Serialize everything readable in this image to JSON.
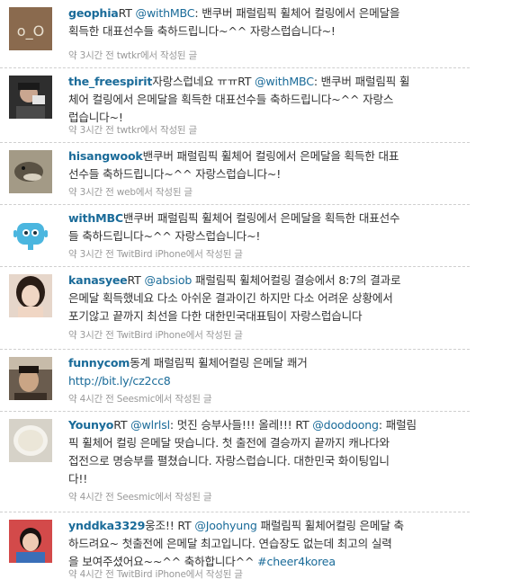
{
  "tweets": [
    {
      "user": "geophia",
      "avatar": "geophia-avatar",
      "parts": [
        "RT ",
        "@withMBC",
        ": 밴쿠버 패럴림픽 휠체어 컬링에서 은메달을",
        "획득한 대표선수들 축하드립니다~^^ 자랑스럽습니다~!"
      ],
      "meta": "약 3시간 전 twtkr에서 작성된 글"
    },
    {
      "user": "the_freespirit",
      "avatar": "person-avatar",
      "parts": [
        "자랑스럽네요 ㅠㅠRT ",
        "@withMBC",
        ": 밴쿠버 패럴림픽 휠",
        "체어 컬링에서 은메달을 획득한 대표선수들 축하드립니다~^^ 자랑스",
        "럽습니다~!"
      ],
      "meta": "약 3시간 전 twtkr에서 작성된 글"
    },
    {
      "user": "hisangwook",
      "avatar": "lizard-avatar",
      "parts": [
        "밴쿠버 패럴림픽 휠체어 컬링에서 은메달을 획득한 대표",
        "선수들 축하드립니다~^^ 자랑스럽습니다~!"
      ],
      "meta": "약 3시간 전 web에서 작성된 글"
    },
    {
      "user": "withMBC",
      "avatar": "robot-avatar",
      "parts": [
        "밴쿠버 패럴림픽 휠체어 컬링에서 은메달을 획득한 대표선수",
        "들 축하드립니다~^^ 자랑스럽습니다~!"
      ],
      "meta": "약 3시간 전 TwitBird iPhone에서 작성된 글"
    },
    {
      "user": "kanasyee",
      "avatar": "girl-avatar",
      "parts": [
        "RT ",
        "@absiob",
        " 패럴림픽 휠체어컬링 결승에서 8:7의 결과로",
        "은메달 획득했네요 다소 아쉬운 결과이긴 하지만 다소 어려운 상황에서",
        "포기않고 끝까지 최선을 다한 대한민국대표팀이 자랑스럽습니다"
      ],
      "meta": "약 3시간 전 TwitBird iPhone에서 작성된 글"
    },
    {
      "user": "funnycom",
      "avatar": "man-avatar",
      "parts": [
        "동계 패럴림픽 휠체어컬링 은메달 쾌거",
        "http://bit.ly/cz2cc8"
      ],
      "meta": "약 4시간 전 Seesmic에서 작성된 글"
    },
    {
      "user": "Younyo",
      "avatar": "cup-avatar",
      "parts": [
        "RT ",
        "@wlrlsl",
        ": 멋진 승부사들!!! 올레!!! RT ",
        "@doodoong",
        ": 패럴림",
        "픽 휠체어 컬링 은메달 땃습니다. 첫 출전에 결승까지 끝까지 캐나다와",
        "접전으로 명승부를 펼쳤습니다. 자랑스럽습니다. 대한민국 화이팅입니",
        "다!!"
      ],
      "meta": "약 4시간 전 Seesmic에서 작성된 글"
    },
    {
      "user": "ynddka3329",
      "avatar": "child-avatar",
      "parts": [
        "웅조!! RT ",
        "@Joohyung",
        " 패럴림픽 휠체어컬링 은메달 축",
        "하드려요~ 첫출전에 은메달 최고입니다. 연습장도 없는데 최고의 실력",
        "을 보여주셨어요~~^^ 축하합니다^^ ",
        "#cheer4korea"
      ],
      "meta": "약 4시간 전 TwitBird iPhone에서 작성된 글"
    }
  ]
}
